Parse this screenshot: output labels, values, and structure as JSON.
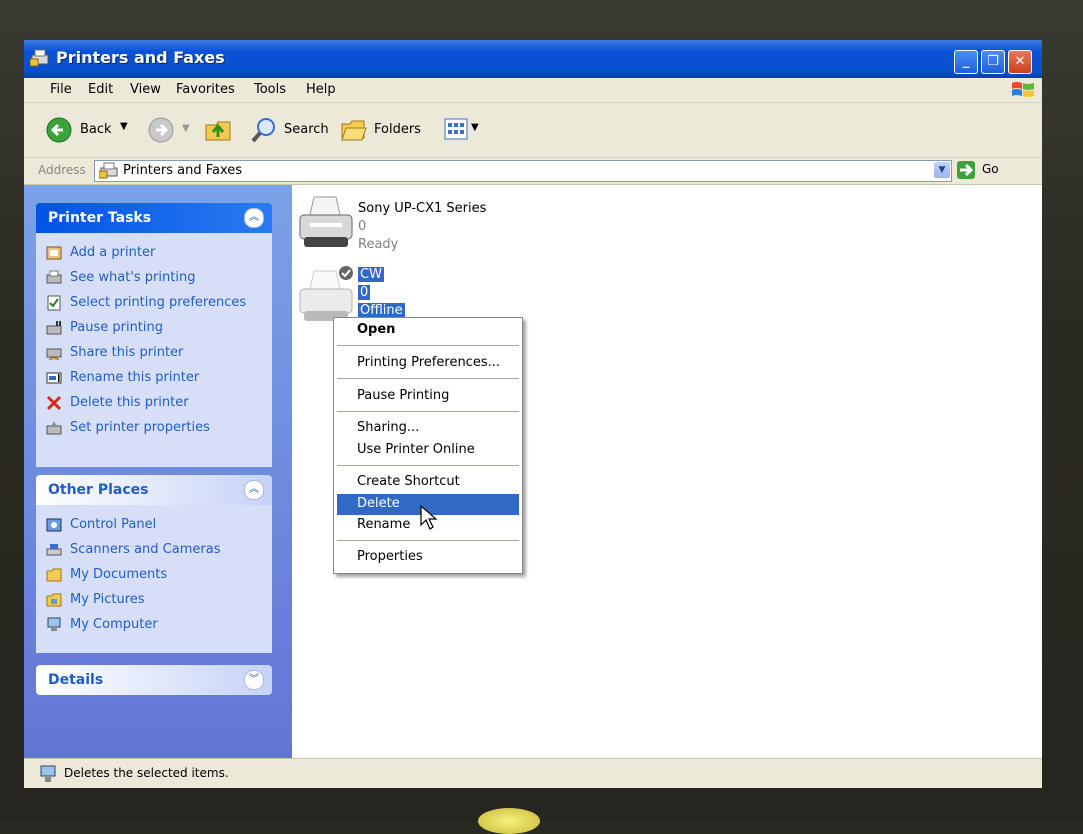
{
  "window": {
    "title": "Printers and Faxes"
  },
  "menubar": {
    "items": [
      "File",
      "Edit",
      "View",
      "Favorites",
      "Tools",
      "Help"
    ]
  },
  "toolbar": {
    "back_label": "Back",
    "search_label": "Search",
    "folders_label": "Folders"
  },
  "address": {
    "label": "Address",
    "value": "Printers and Faxes",
    "go_label": "Go"
  },
  "printer_tasks": {
    "title": "Printer Tasks",
    "items": [
      "Add a printer",
      "See what's printing",
      "Select printing preferences",
      "Pause printing",
      "Share this printer",
      "Rename this printer",
      "Delete this printer",
      "Set printer properties"
    ]
  },
  "other_places": {
    "title": "Other Places",
    "items": [
      "Control Panel",
      "Scanners and Cameras",
      "My Documents",
      "My Pictures",
      "My Computer"
    ]
  },
  "details": {
    "title": "Details"
  },
  "printers": [
    {
      "name": "Sony UP-CX1 Series",
      "docs": "0",
      "status": "Ready"
    },
    {
      "name": "CW",
      "docs": "0",
      "status": "Offline"
    }
  ],
  "context_menu": {
    "items": [
      "Open",
      "Printing Preferences...",
      "Pause Printing",
      "Sharing...",
      "Use Printer Online",
      "Create Shortcut",
      "Delete",
      "Rename",
      "Properties"
    ],
    "highlighted": "Delete"
  },
  "status_bar": {
    "text": "Deletes the selected items."
  },
  "colors": {
    "title_blue": "#0a52d6",
    "selection": "#316ac5",
    "task_link": "#215dc6"
  }
}
